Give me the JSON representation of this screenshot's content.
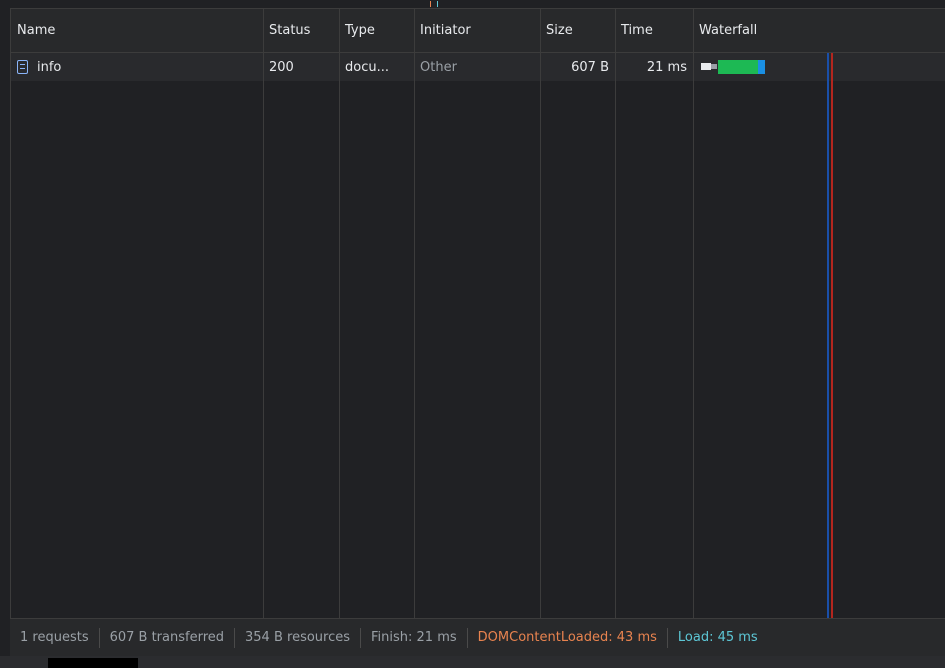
{
  "columns": {
    "name": "Name",
    "status": "Status",
    "type": "Type",
    "initiator": "Initiator",
    "size": "Size",
    "time": "Time",
    "waterfall": "Waterfall"
  },
  "requests": [
    {
      "name": "info",
      "icon": "document-icon",
      "status": "200",
      "type": "docu...",
      "initiator": "Other",
      "size": "607 B",
      "time": "21 ms"
    }
  ],
  "summary": {
    "requests": "1 requests",
    "transferred": "607 B transferred",
    "resources": "354 B resources",
    "finish": "Finish: 21 ms",
    "dom_content_loaded": "DOMContentLoaded: 43 ms",
    "load": "Load: 45 ms"
  },
  "colors": {
    "dom_content_loaded": "#e8834f",
    "load": "#5dc7d6",
    "waterfall_download": "#1db954",
    "waterfall_end": "#1a8fe3"
  }
}
